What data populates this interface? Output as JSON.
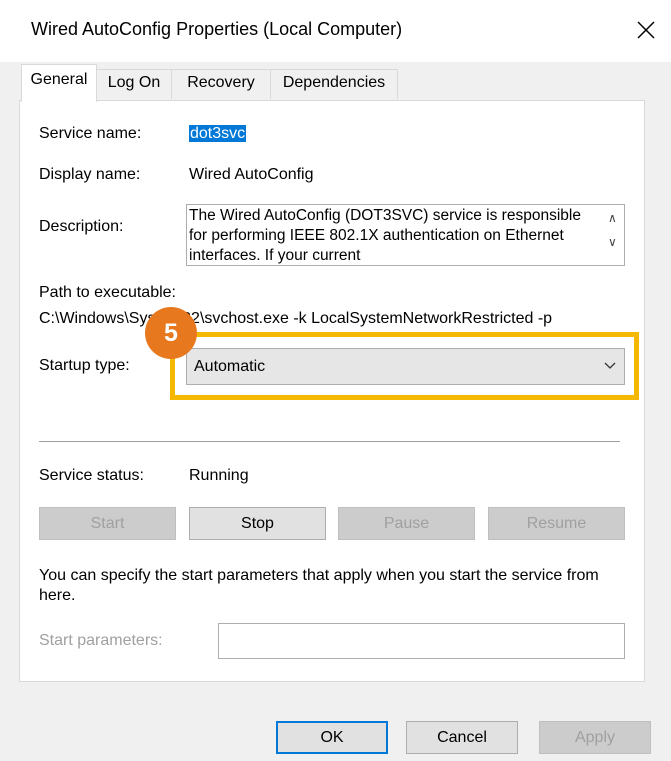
{
  "window": {
    "title": "Wired AutoConfig Properties (Local Computer)"
  },
  "tabs": [
    {
      "label": "General"
    },
    {
      "label": "Log On"
    },
    {
      "label": "Recovery"
    },
    {
      "label": "Dependencies"
    }
  ],
  "general": {
    "service_name_label": "Service name:",
    "service_name_value": "dot3svc",
    "display_name_label": "Display name:",
    "display_name_value": "Wired AutoConfig",
    "description_label": "Description:",
    "description_value": "The Wired AutoConfig (DOT3SVC) service is responsible for performing IEEE 802.1X authentication on Ethernet interfaces. If your current",
    "path_label": "Path to executable:",
    "path_value": "C:\\Windows\\System32\\svchost.exe -k LocalSystemNetworkRestricted -p",
    "startup_type_label": "Startup type:",
    "startup_type_value": "Automatic",
    "service_status_label": "Service status:",
    "service_status_value": "Running",
    "note": "You can specify the start parameters that apply when you start the service from here.",
    "start_parameters_label": "Start parameters:",
    "start_parameters_value": ""
  },
  "service_buttons": {
    "start": "Start",
    "stop": "Stop",
    "pause": "Pause",
    "resume": "Resume"
  },
  "dialog_buttons": {
    "ok": "OK",
    "cancel": "Cancel",
    "apply": "Apply"
  },
  "annotation": {
    "step": "5",
    "color": "#f5b800",
    "badge_color": "#e8781e"
  }
}
